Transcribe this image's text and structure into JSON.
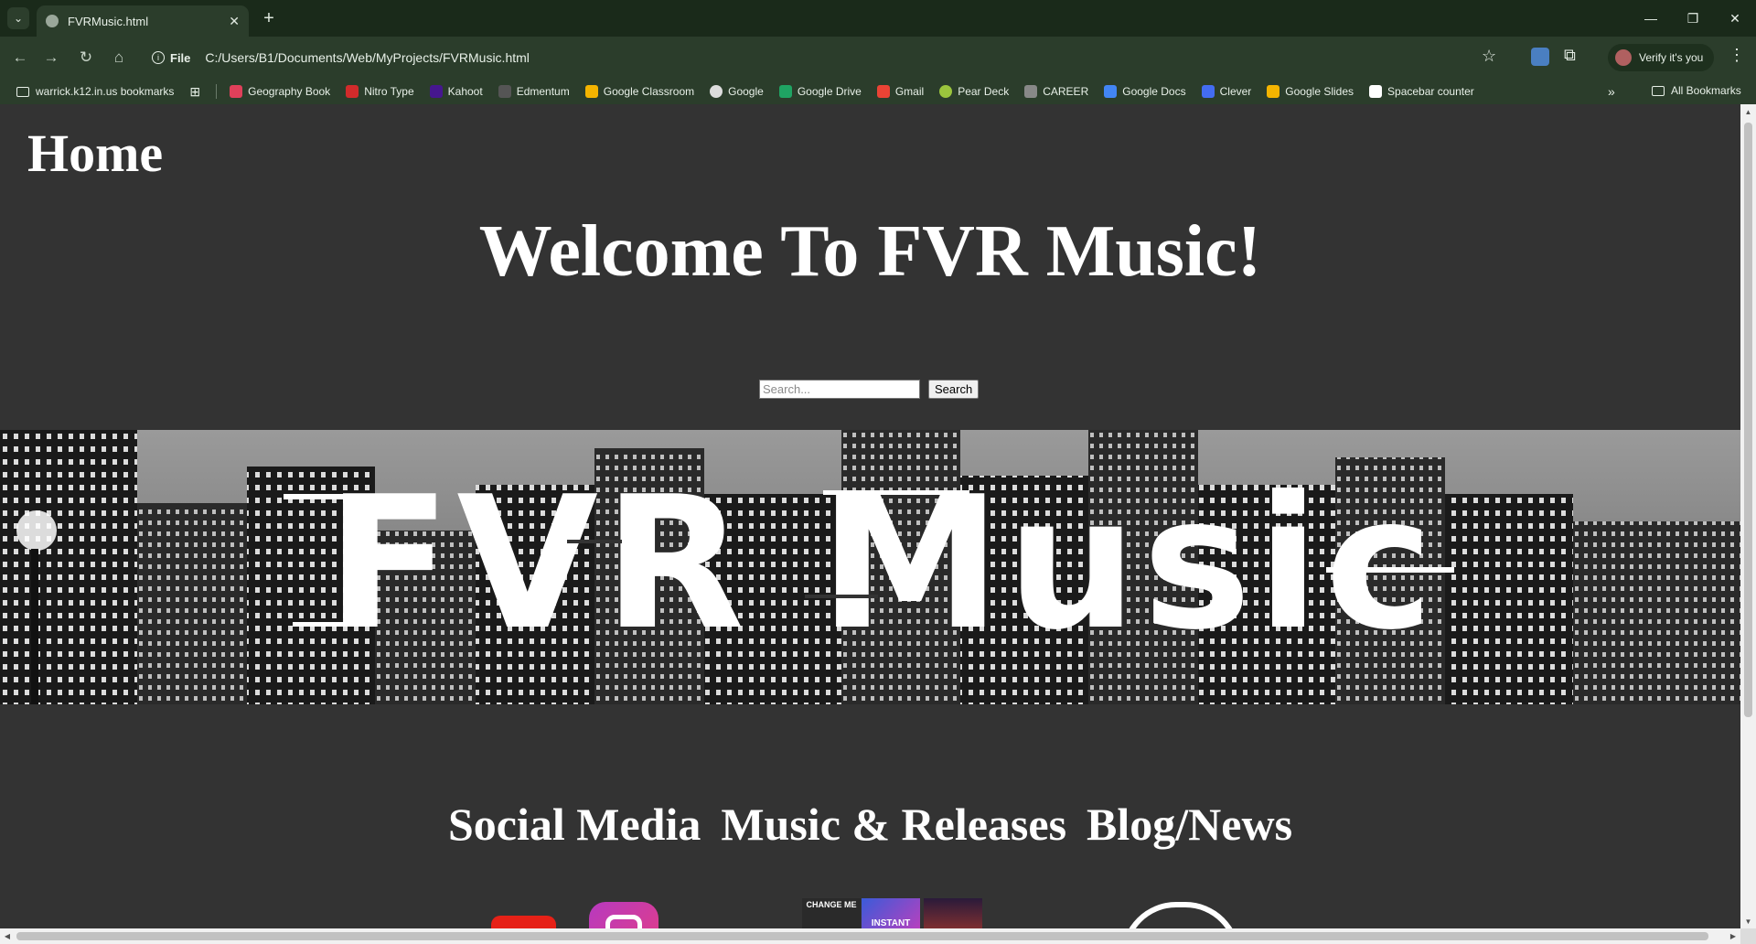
{
  "browser": {
    "tab_title": "FVRMusic.html",
    "url_scheme": "File",
    "url": "C:/Users/B1/Documents/Web/MyProjects/FVRMusic.html",
    "profile_label": "Verify it's you",
    "window_controls": [
      "minimize",
      "restore",
      "close"
    ]
  },
  "bookmarks": [
    {
      "label": "warrick.k12.in.us bookmarks",
      "icon": "folder-icon"
    },
    {
      "label": "Geography Book",
      "icon": "geography-book-icon",
      "color": "#e0405a"
    },
    {
      "label": "Nitro Type",
      "icon": "nitro-type-icon",
      "color": "#d12b2b"
    },
    {
      "label": "Kahoot",
      "icon": "kahoot-icon",
      "color": "#46178f"
    },
    {
      "label": "Edmentum",
      "icon": "edmentum-icon",
      "color": "#555555"
    },
    {
      "label": "Google Classroom",
      "icon": "google-classroom-icon",
      "color": "#f4b400"
    },
    {
      "label": "Google",
      "icon": "google-icon",
      "color": "#dddddd"
    },
    {
      "label": "Google Drive",
      "icon": "google-drive-icon",
      "color": "#1fa463"
    },
    {
      "label": "Gmail",
      "icon": "gmail-icon",
      "color": "#ea4335"
    },
    {
      "label": "Pear Deck",
      "icon": "pear-deck-icon",
      "color": "#9bc53d"
    },
    {
      "label": "CAREER",
      "icon": "career-icon",
      "color": "#888888"
    },
    {
      "label": "Google Docs",
      "icon": "google-docs-icon",
      "color": "#4285f4"
    },
    {
      "label": "Clever",
      "icon": "clever-icon",
      "color": "#436cf2"
    },
    {
      "label": "Google Slides",
      "icon": "google-slides-icon",
      "color": "#f4b400"
    },
    {
      "label": "Spacebar counter",
      "icon": "spacebar-counter-icon",
      "color": "#ffffff"
    }
  ],
  "bookmarks_all_label": "All Bookmarks",
  "page": {
    "home_title": "Home",
    "welcome_heading": "Welcome To FVR Music!",
    "search_placeholder": "Search...",
    "search_button": "Search",
    "banner_text": "FVR Music",
    "nav_headings": [
      "Social Media",
      "Music & Releases",
      "Blog/News"
    ],
    "album_labels": [
      "CHANGE ME",
      "INSTANT"
    ]
  }
}
